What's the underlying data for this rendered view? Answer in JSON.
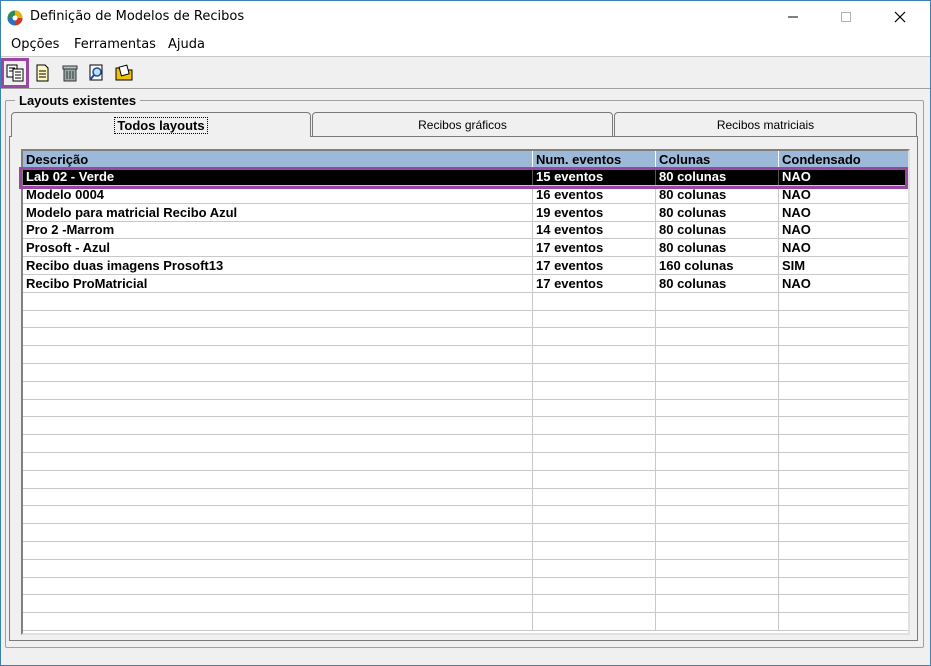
{
  "window": {
    "title": "Definição de Modelos de Recibos"
  },
  "menu": {
    "items": [
      {
        "label": "Opções"
      },
      {
        "label": "Ferramentas"
      },
      {
        "label": "Ajuda"
      }
    ]
  },
  "toolbar": {
    "buttons": [
      {
        "icon": "copy-document-icon",
        "selected": true
      },
      {
        "icon": "new-document-icon",
        "selected": false
      },
      {
        "icon": "recycle-bin-icon",
        "selected": false
      },
      {
        "icon": "preview-magnifier-icon",
        "selected": false
      },
      {
        "icon": "edit-folder-icon",
        "selected": false
      }
    ]
  },
  "group": {
    "label": "Layouts existentes"
  },
  "tabs": [
    {
      "label": "Todos layouts",
      "active": true
    },
    {
      "label": "Recibos gráficos",
      "active": false
    },
    {
      "label": "Recibos matriciais",
      "active": false
    }
  ],
  "table": {
    "columns": [
      "Descrição",
      "Num. eventos",
      "Colunas",
      "Condensado"
    ],
    "rows": [
      [
        "Lab 02 - Verde",
        "15 eventos",
        "80 colunas",
        "NAO"
      ],
      [
        "Modelo 0004",
        "16 eventos",
        "80 colunas",
        "NAO"
      ],
      [
        "Modelo para matricial Recibo Azul",
        "19 eventos",
        "80 colunas",
        "NAO"
      ],
      [
        "Pro 2 -Marrom",
        "14 eventos",
        "80 colunas",
        "NAO"
      ],
      [
        "Prosoft - Azul",
        "17 eventos",
        "80 colunas",
        "NAO"
      ],
      [
        "Recibo duas imagens Prosoft13",
        "17 eventos",
        "160 colunas",
        "SIM"
      ],
      [
        "Recibo ProMatricial",
        "17 eventos",
        "80 colunas",
        "NAO"
      ]
    ],
    "selected_row": 0
  },
  "colors": {
    "header_bg": "#9db9da",
    "selection_bg": "#000000",
    "highlight_outline": "#9a46a5"
  }
}
